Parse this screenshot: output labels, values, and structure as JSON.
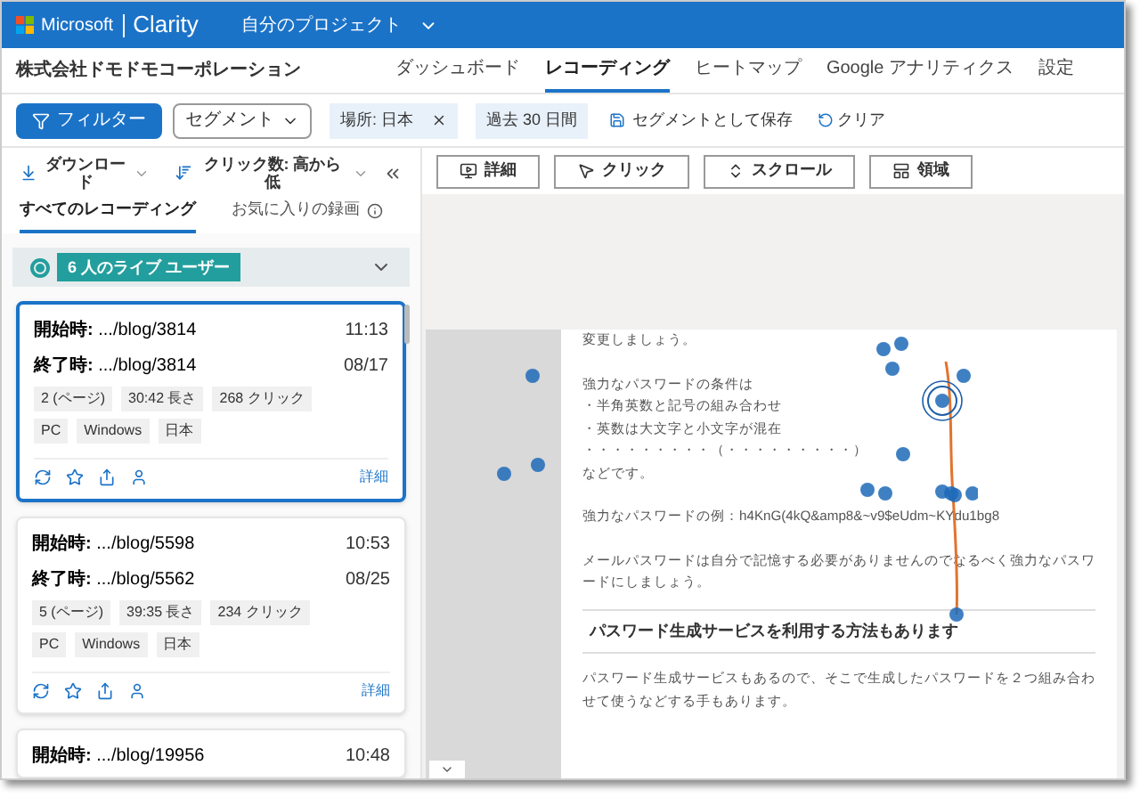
{
  "header": {
    "brand": "Microsoft",
    "product": "Clarity",
    "project": "自分のプロジェクト"
  },
  "nav": {
    "company": "株式会社ドモドモコーポレーション",
    "tabs": [
      {
        "label": "ダッシュボード",
        "selected": false
      },
      {
        "label": "レコーディング",
        "selected": true
      },
      {
        "label": "ヒートマップ",
        "selected": false
      },
      {
        "label": "Google アナリティクス",
        "selected": false
      },
      {
        "label": "設定",
        "selected": false
      }
    ]
  },
  "filters": {
    "filter_button": "フィルター",
    "segment_dropdown": "セグメント",
    "chips": [
      {
        "label": "場所: 日本",
        "removable": true
      },
      {
        "label": "過去 30 日間",
        "removable": false
      }
    ],
    "save": "セグメントとして保存",
    "clear": "クリア"
  },
  "sidebar": {
    "download": "ダウンロード",
    "sort": "クリック数: 高から低",
    "tabs": [
      {
        "label": "すべてのレコーディング",
        "selected": true
      },
      {
        "label": "お気に入りの録画",
        "selected": false
      }
    ],
    "live_users": "6 人のライブ ユーザー",
    "recordings": [
      {
        "selected": true,
        "start": "**開始時:** .../blog/3814",
        "time": "11:13",
        "end": "**終了時:** .../blog/3814",
        "date": "08/17",
        "stats": [
          "2 (ページ)",
          "30:42 長さ",
          "268 クリック"
        ],
        "tags": [
          "PC",
          "Windows",
          "日本"
        ],
        "detail": "詳細"
      },
      {
        "selected": false,
        "start": "**開始時:** .../blog/5598",
        "time": "10:53",
        "end": "**終了時:** .../blog/5562",
        "date": "08/25",
        "stats": [
          "5 (ページ)",
          "39:35 長さ",
          "234 クリック"
        ],
        "tags": [
          "PC",
          "Windows",
          "日本"
        ],
        "detail": "詳細"
      },
      {
        "selected": false,
        "start": "**開始時:** .../blog/19956",
        "time": "10:48"
      }
    ]
  },
  "toolbar": [
    "詳細",
    "クリック",
    "スクロール",
    "領域"
  ],
  "page": [
    {
      "kind": "paragraph",
      "text": "変更しましょう。"
    },
    {
      "kind": "gap"
    },
    {
      "kind": "paragraph",
      "text": "強力なパスワードの条件は"
    },
    {
      "kind": "paragraph",
      "text": "・半角英数と記号の組み合わせ"
    },
    {
      "kind": "paragraph",
      "text": "・英数は大文字と小文字が混在"
    },
    {
      "kind": "paragraph",
      "text": "・・・・・・・・・（・・・・・・・・・）"
    },
    {
      "kind": "paragraph",
      "text": "などです。"
    },
    {
      "kind": "gap"
    },
    {
      "kind": "paragraph",
      "text": "強力なパスワードの例：h4KnG(4kQ&amp8&~v9$eUdm~KYdu1bg8"
    },
    {
      "kind": "gap"
    },
    {
      "kind": "paragraph",
      "text": "メールパスワードは自分で記憶する必要がありませんのでなるべく強力なパスワードにしましょう。"
    },
    {
      "kind": "heading",
      "text": "パスワード生成サービスを利用する方法もあります"
    },
    {
      "kind": "paragraph",
      "text": "パスワード生成サービスもあるので、そこで生成したパスワードを２つ組み合わせて使うなどする手もあります。"
    }
  ]
}
